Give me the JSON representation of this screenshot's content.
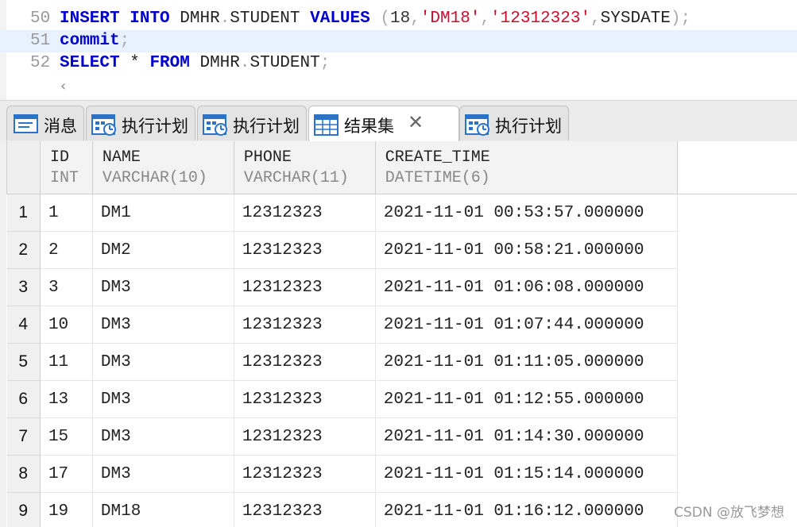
{
  "editor": {
    "lines": [
      {
        "number": "50",
        "tokens": [
          {
            "t": "INSERT",
            "c": "kw"
          },
          {
            "t": " ",
            "c": "op"
          },
          {
            "t": "INTO",
            "c": "kw"
          },
          {
            "t": " ",
            "c": "op"
          },
          {
            "t": "DMHR",
            "c": "id"
          },
          {
            "t": ".",
            "c": "punc"
          },
          {
            "t": "STUDENT",
            "c": "id"
          },
          {
            "t": " ",
            "c": "op"
          },
          {
            "t": "VALUES",
            "c": "kw"
          },
          {
            "t": " ",
            "c": "op"
          },
          {
            "t": "(",
            "c": "punc"
          },
          {
            "t": "18",
            "c": "num"
          },
          {
            "t": ",",
            "c": "punc"
          },
          {
            "t": "'DM18'",
            "c": "str"
          },
          {
            "t": ",",
            "c": "punc"
          },
          {
            "t": "'12312323'",
            "c": "str"
          },
          {
            "t": ",",
            "c": "punc"
          },
          {
            "t": "SYSDATE",
            "c": "id"
          },
          {
            "t": ");",
            "c": "punc"
          }
        ]
      },
      {
        "number": "51",
        "current": true,
        "tokens": [
          {
            "t": "commit",
            "c": "kw"
          },
          {
            "t": ";",
            "c": "punc"
          }
        ]
      },
      {
        "number": "52",
        "tokens": [
          {
            "t": "SELECT",
            "c": "kw"
          },
          {
            "t": " * ",
            "c": "op"
          },
          {
            "t": "FROM",
            "c": "kw"
          },
          {
            "t": " ",
            "c": "op"
          },
          {
            "t": "DMHR",
            "c": "id"
          },
          {
            "t": ".",
            "c": "punc"
          },
          {
            "t": "STUDENT",
            "c": "id"
          },
          {
            "t": ";",
            "c": "punc"
          }
        ]
      }
    ],
    "scroll_left_glyph": "‹"
  },
  "tabs": [
    {
      "label": "消息",
      "icon": "message-icon",
      "active": false
    },
    {
      "label": "执行计划",
      "icon": "execution-plan-icon",
      "active": false
    },
    {
      "label": "执行计划",
      "icon": "execution-plan-icon",
      "active": false
    },
    {
      "label": "结果集",
      "icon": "result-grid-icon",
      "active": true,
      "close": "✕"
    },
    {
      "label": "执行计划",
      "icon": "execution-plan-icon",
      "active": false
    }
  ],
  "grid": {
    "columns": [
      {
        "name": "ID",
        "type": "INT"
      },
      {
        "name": "NAME",
        "type": "VARCHAR(10)"
      },
      {
        "name": "PHONE",
        "type": "VARCHAR(11)"
      },
      {
        "name": "CREATE_TIME",
        "type": "DATETIME(6)"
      }
    ],
    "rows": [
      {
        "n": "1",
        "cells": [
          "1",
          "DM1",
          "12312323",
          "2021-11-01 00:53:57.000000"
        ]
      },
      {
        "n": "2",
        "cells": [
          "2",
          "DM2",
          "12312323",
          "2021-11-01 00:58:21.000000"
        ]
      },
      {
        "n": "3",
        "cells": [
          "3",
          "DM3",
          "12312323",
          "2021-11-01 01:06:08.000000"
        ]
      },
      {
        "n": "4",
        "cells": [
          "10",
          "DM3",
          "12312323",
          "2021-11-01 01:07:44.000000"
        ]
      },
      {
        "n": "5",
        "cells": [
          "11",
          "DM3",
          "12312323",
          "2021-11-01 01:11:05.000000"
        ]
      },
      {
        "n": "6",
        "cells": [
          "13",
          "DM3",
          "12312323",
          "2021-11-01 01:12:55.000000"
        ]
      },
      {
        "n": "7",
        "cells": [
          "15",
          "DM3",
          "12312323",
          "2021-11-01 01:14:30.000000"
        ]
      },
      {
        "n": "8",
        "cells": [
          "17",
          "DM3",
          "12312323",
          "2021-11-01 01:15:14.000000"
        ]
      },
      {
        "n": "9",
        "cells": [
          "19",
          "DM18",
          "12312323",
          "2021-11-01 01:16:12.000000"
        ]
      }
    ]
  },
  "watermark": "CSDN @放飞梦想",
  "colors": {
    "keyword": "#0000cc",
    "string": "#c8102e",
    "current_line": "#e8f2fe",
    "accent": "#2a73c9"
  }
}
